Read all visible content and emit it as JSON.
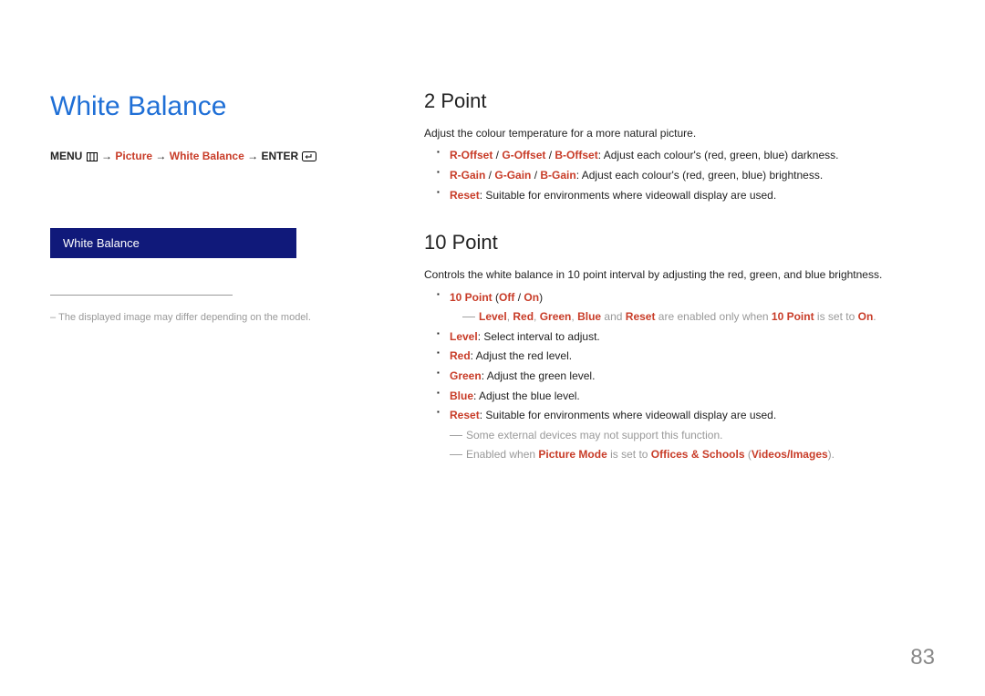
{
  "left": {
    "title": "White Balance",
    "breadcrumb": {
      "menu": "MENU",
      "arrow": "→",
      "picture": "Picture",
      "white_balance": "White Balance",
      "enter": "ENTER"
    },
    "menu_box": "White Balance",
    "note": "The displayed image may differ depending on the model."
  },
  "right": {
    "s1": {
      "title": "2 Point",
      "intro": "Adjust the colour temperature for a more natural picture.",
      "b1": {
        "a1": "R-Offset",
        "a2": "G-Offset",
        "a3": "B-Offset",
        "rest": ": Adjust each colour's (red, green, blue) darkness."
      },
      "b2": {
        "a1": "R-Gain",
        "a2": "G-Gain",
        "a3": "B-Gain",
        "rest": ": Adjust each colour's (red, green, blue) brightness."
      },
      "b3": {
        "a1": "Reset",
        "rest": ": Suitable for environments where videowall display are used."
      }
    },
    "s2": {
      "title": "10 Point",
      "intro": "Controls the white balance in 10 point interval by adjusting the red, green, and blue brightness.",
      "b1": {
        "a1": "10 Point",
        "p1": "(",
        "a2": "Off",
        "sep": "/",
        "a3": "On",
        "p2": ")"
      },
      "sub1": {
        "a1": "Level",
        "c": ", ",
        "a2": "Red",
        "a3": "Green",
        "a4": "Blue",
        "and": " and ",
        "a5": "Reset",
        "mid": " are enabled only when ",
        "a6": "10 Point",
        "end": " is set to ",
        "a7": "On",
        "dot": "."
      },
      "b2": {
        "a1": "Level",
        "rest": ": Select interval to adjust."
      },
      "b3": {
        "a1": "Red",
        "rest": ": Adjust the red level."
      },
      "b4": {
        "a1": "Green",
        "rest": ": Adjust the green level."
      },
      "b5": {
        "a1": "Blue",
        "rest": ": Adjust the blue level."
      },
      "b6": {
        "a1": "Reset",
        "rest": ": Suitable for environments where videowall display are used."
      },
      "n1": "Some external devices may not support this function.",
      "n2": {
        "pre": "Enabled when ",
        "a1": "Picture Mode",
        "mid": " is set to ",
        "a2": "Offices & Schools",
        "p1": " (",
        "a3": "Videos/Images",
        "p2": ")."
      }
    }
  },
  "page_number": "83"
}
